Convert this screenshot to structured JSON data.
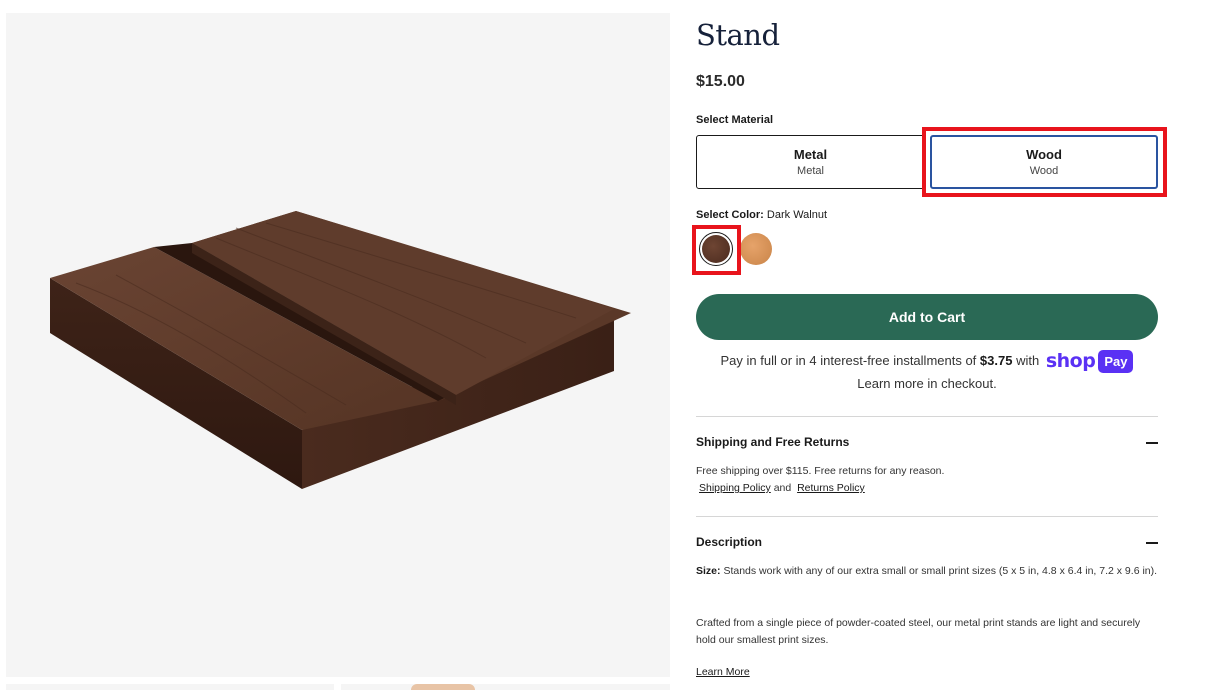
{
  "product": {
    "title": "Stand",
    "price": "$15.00",
    "image_alt": "wood-stand-image"
  },
  "material": {
    "label": "Select Material",
    "options": [
      {
        "title": "Metal",
        "subtitle": "Metal",
        "selected": false
      },
      {
        "title": "Wood",
        "subtitle": "Wood",
        "selected": true
      }
    ]
  },
  "color": {
    "label": "Select Color:",
    "value": "Dark Walnut",
    "swatches": [
      {
        "name": "Dark Walnut",
        "color": "#5a3526",
        "selected": true
      },
      {
        "name": "Oak",
        "color": "#d99256",
        "selected": false
      }
    ]
  },
  "cart": {
    "add_label": "Add to Cart",
    "installments_prefix": "Pay in full or in 4 interest-free installments of",
    "installment_amount": "$3.75",
    "installments_with": "with",
    "shop_word": "shop",
    "pay_word": "Pay",
    "learn_more_checkout": "Learn more in checkout."
  },
  "shipping": {
    "title": "Shipping and Free Returns",
    "text": "Free shipping over $115. Free returns for any reason.",
    "shipping_policy_link": "Shipping Policy",
    "and": "and",
    "returns_policy_link": "Returns Policy"
  },
  "description": {
    "title": "Description",
    "size_label": "Size:",
    "size_text": "Stands work with any of our extra small or small print sizes (5 x 5 in, 4.8 x 6.4 in, 7.2 x 9.6 in).",
    "crafted_text": "Crafted from a single piece of powder-coated steel, our metal print stands are light and securely hold our smallest print sizes.",
    "learn_more": "Learn More"
  },
  "colors": {
    "accent_green": "#2a6955",
    "selected_border": "#2a54a0",
    "highlight_red": "#e8141c",
    "shop_pay_purple": "#5a31f4"
  }
}
